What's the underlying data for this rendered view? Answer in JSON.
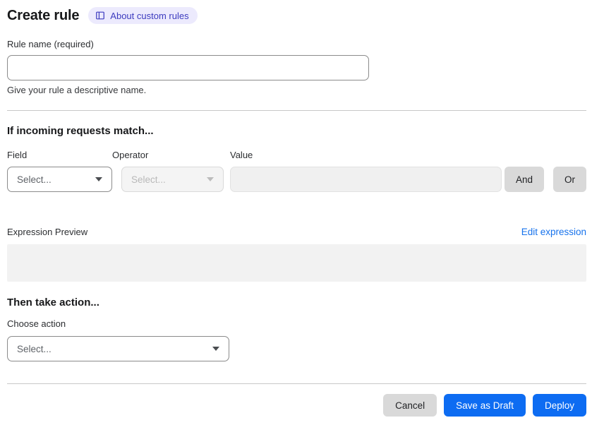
{
  "header": {
    "title": "Create rule",
    "about_link_label": "About custom rules"
  },
  "rule_name": {
    "label": "Rule name (required)",
    "value": "",
    "helper": "Give your rule a descriptive name."
  },
  "match_section": {
    "heading": "If incoming requests match...",
    "field": {
      "label": "Field",
      "selected": "Select..."
    },
    "operator": {
      "label": "Operator",
      "selected": "Select...",
      "disabled": true
    },
    "value": {
      "label": "Value",
      "value": "",
      "disabled": true
    },
    "and_button_label": "And",
    "or_button_label": "Or"
  },
  "expression": {
    "label": "Expression Preview",
    "edit_link_label": "Edit expression",
    "content": ""
  },
  "action_section": {
    "heading": "Then take action...",
    "choose_label": "Choose action",
    "select": {
      "selected": "Select..."
    }
  },
  "footer": {
    "cancel_label": "Cancel",
    "save_draft_label": "Save as Draft",
    "deploy_label": "Deploy"
  },
  "icons": {
    "about_custom_rules": "book-icon",
    "dropdown": "triangle-down ▾"
  },
  "colors": {
    "accent_blue": "#0D6CF2",
    "link_blue": "#1672EC",
    "badge_bg": "#ECEAFD",
    "badge_text": "#3C3BBF",
    "gray_button": "#D9D9D9"
  }
}
